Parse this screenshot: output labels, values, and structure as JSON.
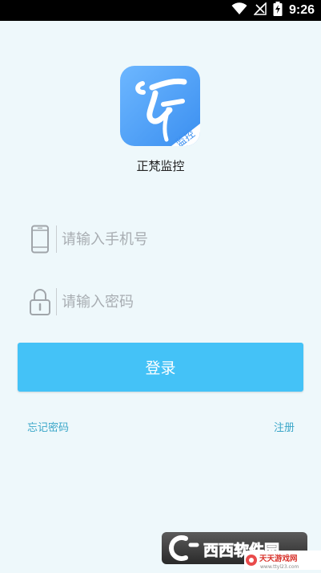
{
  "status_bar": {
    "time": "9:26",
    "icons": [
      "wifi-icon",
      "no-signal-icon",
      "battery-charging-icon"
    ]
  },
  "app": {
    "logo_badge": "监控",
    "name": "正梵监控"
  },
  "form": {
    "phone_placeholder": "请输入手机号",
    "password_placeholder": "请输入密码",
    "login_label": "登录"
  },
  "links": {
    "forgot_password": "忘记密码",
    "register": "注册"
  },
  "watermark": {
    "brand": "西西软件园",
    "sub_brand": "天天游戏网",
    "sub_url": "www.ttyl23.com"
  },
  "colors": {
    "background": "#eef8fb",
    "login_button": "#44c2f7",
    "link": "#3aa6c8",
    "logo_gradient_start": "#6db7ff",
    "logo_gradient_end": "#3b8ff0"
  }
}
